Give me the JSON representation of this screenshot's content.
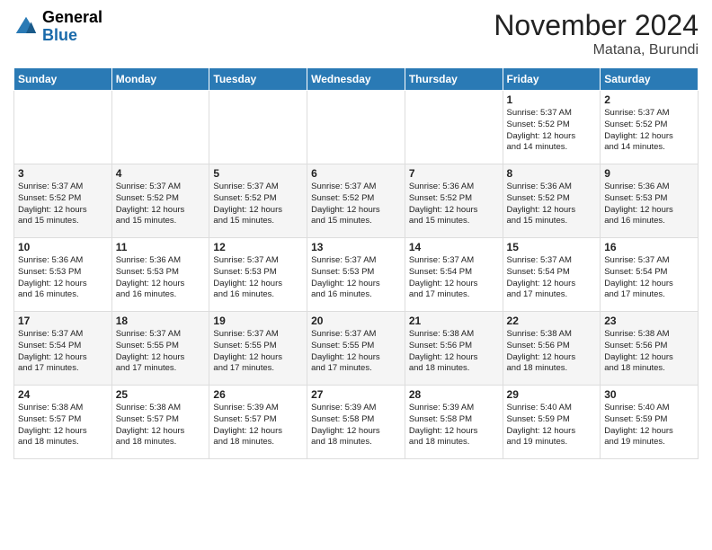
{
  "header": {
    "logo_line1": "General",
    "logo_line2": "Blue",
    "month_year": "November 2024",
    "location": "Matana, Burundi"
  },
  "days_of_week": [
    "Sunday",
    "Monday",
    "Tuesday",
    "Wednesday",
    "Thursday",
    "Friday",
    "Saturday"
  ],
  "weeks": [
    [
      {
        "day": "",
        "info": ""
      },
      {
        "day": "",
        "info": ""
      },
      {
        "day": "",
        "info": ""
      },
      {
        "day": "",
        "info": ""
      },
      {
        "day": "",
        "info": ""
      },
      {
        "day": "1",
        "info": "Sunrise: 5:37 AM\nSunset: 5:52 PM\nDaylight: 12 hours\nand 14 minutes."
      },
      {
        "day": "2",
        "info": "Sunrise: 5:37 AM\nSunset: 5:52 PM\nDaylight: 12 hours\nand 14 minutes."
      }
    ],
    [
      {
        "day": "3",
        "info": "Sunrise: 5:37 AM\nSunset: 5:52 PM\nDaylight: 12 hours\nand 15 minutes."
      },
      {
        "day": "4",
        "info": "Sunrise: 5:37 AM\nSunset: 5:52 PM\nDaylight: 12 hours\nand 15 minutes."
      },
      {
        "day": "5",
        "info": "Sunrise: 5:37 AM\nSunset: 5:52 PM\nDaylight: 12 hours\nand 15 minutes."
      },
      {
        "day": "6",
        "info": "Sunrise: 5:37 AM\nSunset: 5:52 PM\nDaylight: 12 hours\nand 15 minutes."
      },
      {
        "day": "7",
        "info": "Sunrise: 5:36 AM\nSunset: 5:52 PM\nDaylight: 12 hours\nand 15 minutes."
      },
      {
        "day": "8",
        "info": "Sunrise: 5:36 AM\nSunset: 5:52 PM\nDaylight: 12 hours\nand 15 minutes."
      },
      {
        "day": "9",
        "info": "Sunrise: 5:36 AM\nSunset: 5:53 PM\nDaylight: 12 hours\nand 16 minutes."
      }
    ],
    [
      {
        "day": "10",
        "info": "Sunrise: 5:36 AM\nSunset: 5:53 PM\nDaylight: 12 hours\nand 16 minutes."
      },
      {
        "day": "11",
        "info": "Sunrise: 5:36 AM\nSunset: 5:53 PM\nDaylight: 12 hours\nand 16 minutes."
      },
      {
        "day": "12",
        "info": "Sunrise: 5:37 AM\nSunset: 5:53 PM\nDaylight: 12 hours\nand 16 minutes."
      },
      {
        "day": "13",
        "info": "Sunrise: 5:37 AM\nSunset: 5:53 PM\nDaylight: 12 hours\nand 16 minutes."
      },
      {
        "day": "14",
        "info": "Sunrise: 5:37 AM\nSunset: 5:54 PM\nDaylight: 12 hours\nand 17 minutes."
      },
      {
        "day": "15",
        "info": "Sunrise: 5:37 AM\nSunset: 5:54 PM\nDaylight: 12 hours\nand 17 minutes."
      },
      {
        "day": "16",
        "info": "Sunrise: 5:37 AM\nSunset: 5:54 PM\nDaylight: 12 hours\nand 17 minutes."
      }
    ],
    [
      {
        "day": "17",
        "info": "Sunrise: 5:37 AM\nSunset: 5:54 PM\nDaylight: 12 hours\nand 17 minutes."
      },
      {
        "day": "18",
        "info": "Sunrise: 5:37 AM\nSunset: 5:55 PM\nDaylight: 12 hours\nand 17 minutes."
      },
      {
        "day": "19",
        "info": "Sunrise: 5:37 AM\nSunset: 5:55 PM\nDaylight: 12 hours\nand 17 minutes."
      },
      {
        "day": "20",
        "info": "Sunrise: 5:37 AM\nSunset: 5:55 PM\nDaylight: 12 hours\nand 17 minutes."
      },
      {
        "day": "21",
        "info": "Sunrise: 5:38 AM\nSunset: 5:56 PM\nDaylight: 12 hours\nand 18 minutes."
      },
      {
        "day": "22",
        "info": "Sunrise: 5:38 AM\nSunset: 5:56 PM\nDaylight: 12 hours\nand 18 minutes."
      },
      {
        "day": "23",
        "info": "Sunrise: 5:38 AM\nSunset: 5:56 PM\nDaylight: 12 hours\nand 18 minutes."
      }
    ],
    [
      {
        "day": "24",
        "info": "Sunrise: 5:38 AM\nSunset: 5:57 PM\nDaylight: 12 hours\nand 18 minutes."
      },
      {
        "day": "25",
        "info": "Sunrise: 5:38 AM\nSunset: 5:57 PM\nDaylight: 12 hours\nand 18 minutes."
      },
      {
        "day": "26",
        "info": "Sunrise: 5:39 AM\nSunset: 5:57 PM\nDaylight: 12 hours\nand 18 minutes."
      },
      {
        "day": "27",
        "info": "Sunrise: 5:39 AM\nSunset: 5:58 PM\nDaylight: 12 hours\nand 18 minutes."
      },
      {
        "day": "28",
        "info": "Sunrise: 5:39 AM\nSunset: 5:58 PM\nDaylight: 12 hours\nand 18 minutes."
      },
      {
        "day": "29",
        "info": "Sunrise: 5:40 AM\nSunset: 5:59 PM\nDaylight: 12 hours\nand 19 minutes."
      },
      {
        "day": "30",
        "info": "Sunrise: 5:40 AM\nSunset: 5:59 PM\nDaylight: 12 hours\nand 19 minutes."
      }
    ]
  ]
}
